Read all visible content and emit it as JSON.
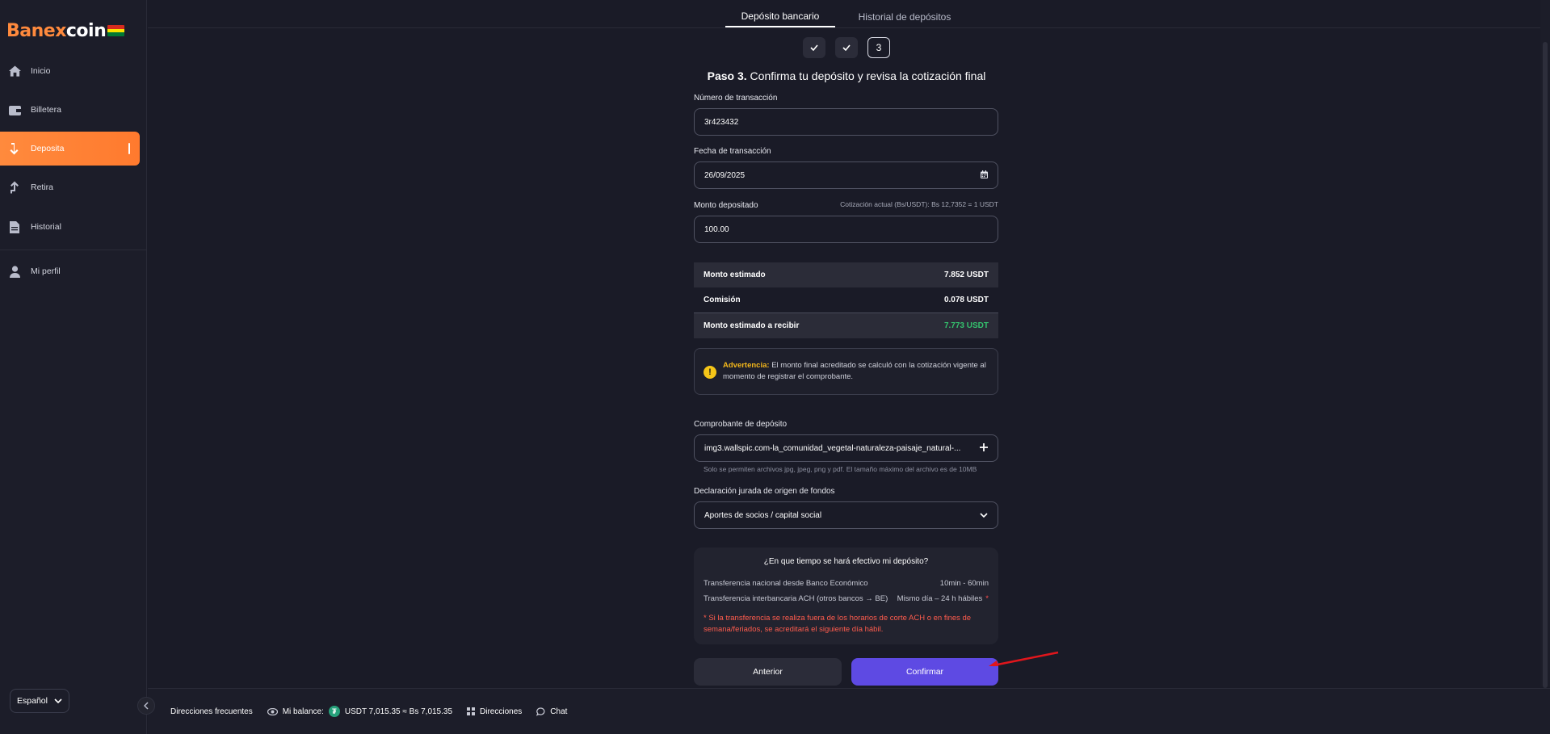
{
  "brand": {
    "name_part1": "Banex",
    "name_part2": "coin",
    "flag_colors": [
      "#d52b1e",
      "#f9e300",
      "#007934"
    ]
  },
  "sidebar": {
    "items": [
      {
        "label": "Inicio",
        "icon": "home-icon"
      },
      {
        "label": "Billetera",
        "icon": "wallet-icon"
      },
      {
        "label": "Deposita",
        "icon": "arrow-down-icon",
        "active": true
      },
      {
        "label": "Retira",
        "icon": "arrow-up-icon"
      },
      {
        "label": "Historial",
        "icon": "document-icon"
      },
      {
        "label": "Mi perfil",
        "icon": "user-icon"
      }
    ],
    "language": "Español"
  },
  "tabs": [
    {
      "label": "Depósito bancario",
      "active": true
    },
    {
      "label": "Historial de depósitos",
      "active": false
    }
  ],
  "steps": {
    "current": "3"
  },
  "title": {
    "bold": "Paso 3.",
    "text": " Confirma tu depósito y revisa la cotización final"
  },
  "form": {
    "transaction_number": {
      "label": "Número de transacción",
      "value": "3r423432"
    },
    "transaction_date": {
      "label": "Fecha de transacción",
      "value": "26/09/2025"
    },
    "amount": {
      "label": "Monto depositado",
      "quote": "Cotización actual (Bs/USDT): Bs 12,7352 = 1 USDT",
      "value": "100.00"
    },
    "receipt": {
      "label": "Comprobante de depósito",
      "value": "img3.wallspic.com-la_comunidad_vegetal-naturaleza-paisaje_natural-...",
      "hint": "Solo se permiten archivos jpg, jpeg, png y pdf. El tamaño máximo del archivo es de 10MB"
    },
    "declaration": {
      "label": "Declaración jurada de origen de fondos",
      "value": "Aportes de socios / capital social"
    }
  },
  "summary": [
    {
      "label": "Monto estimado",
      "value": "7.852 USDT"
    },
    {
      "label": "Comisión",
      "value": "0.078 USDT"
    },
    {
      "label": "Monto estimado a recibir",
      "value": "7.773 USDT"
    }
  ],
  "warning": {
    "title": "Advertencia:",
    "text": " El monto final acreditado se calculó con la cotización vigente al momento de registrar el comprobante."
  },
  "info": {
    "question": "¿En que tiempo se hará efectivo mi depósito?",
    "rows": [
      {
        "label": "Transferencia nacional desde Banco Económico",
        "value": "10min - 60min"
      },
      {
        "label": "Transferencia interbancaria ACH (otros bancos → BE)",
        "value": "Mismo día – 24 h hábiles",
        "star": "*"
      }
    ],
    "note": "* Si la transferencia se realiza fuera de los horarios de corte ACH o en fines de semana/feriados, se acreditará el siguiente día hábil."
  },
  "buttons": {
    "previous": "Anterior",
    "confirm": "Confirmar"
  },
  "bottombar": {
    "frequent": "Direcciones frecuentes",
    "balance_label": "Mi balance:",
    "balance_value": "USDT 7,015.35 ≈ Bs 7,015.35",
    "addresses": "Direcciones",
    "chat": "Chat"
  },
  "colors": {
    "accent": "#ff8a3d",
    "primary": "#5e4ae3",
    "positive": "#34c26e",
    "warning": "#f5b81a",
    "error": "#ff5c4d",
    "annotation_arrow": "#e0161c"
  }
}
